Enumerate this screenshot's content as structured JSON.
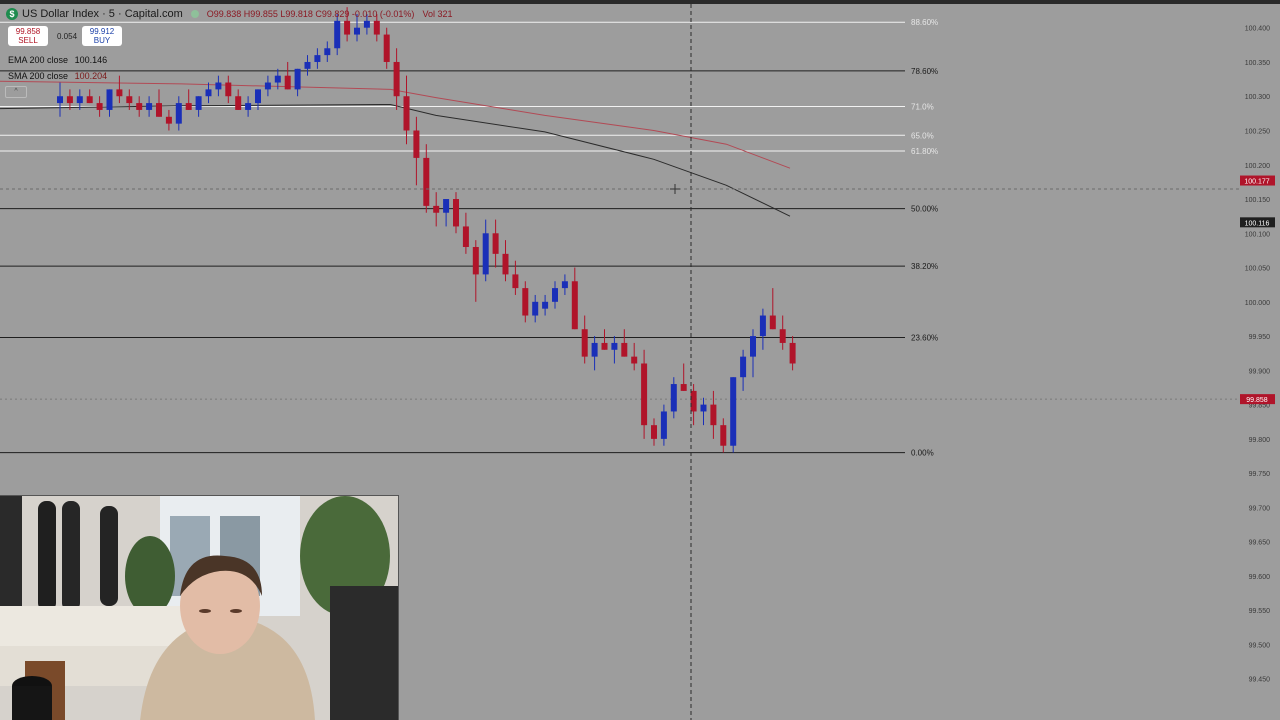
{
  "header": {
    "title": "US Dollar Index · 5 · Capital.com",
    "ohlc": "O99.838  H99.855  L99.818  C99.829  -0.010 (-0.01%)",
    "volume": "Vol 321"
  },
  "trade": {
    "sell_price": "99.858",
    "sell_label": "SELL",
    "spread": "0.054",
    "buy_price": "99.912",
    "buy_label": "BUY"
  },
  "indicators": [
    {
      "label": "EMA 200 close",
      "value": "100.146",
      "value2": ""
    },
    {
      "label": "SMA 200 close",
      "value": "100.204",
      "value2": ""
    }
  ],
  "colors": {
    "background": "#9d9d9d",
    "bull": "#1a2fb8",
    "bear": "#b0142a",
    "ema": "#2b2b2b",
    "sma": "#b24a55",
    "fib_line": "#1f1f1f",
    "fib_white": "#f2f2f2"
  },
  "chart_data": {
    "type": "candlestick",
    "title": "US Dollar Index · 5 · Capital.com",
    "y_axis_ticks": [
      "100.400",
      "100.350",
      "100.300",
      "100.250",
      "100.200",
      "100.150",
      "100.100",
      "100.050",
      "100.000",
      "99.950",
      "99.900",
      "99.850",
      "99.800",
      "99.750",
      "99.700",
      "99.650",
      "99.600",
      "99.550",
      "99.500",
      "99.450"
    ],
    "ylim": [
      99.435,
      100.42
    ],
    "price_labels": [
      {
        "text": "100.177",
        "value": 100.177,
        "color": "#b0142a"
      },
      {
        "text": "100.116",
        "value": 100.116,
        "color": "#1f1f1f"
      },
      {
        "text": "99.858",
        "value": 99.858,
        "color": "#b0142a"
      }
    ],
    "fib_levels": [
      {
        "label": "88.60%",
        "value": 100.408,
        "style": "white"
      },
      {
        "label": "78.60%",
        "value": 100.337,
        "style": "dark"
      },
      {
        "label": "71.0%",
        "value": 100.285,
        "style": "white"
      },
      {
        "label": "65.0%",
        "value": 100.243,
        "style": "white"
      },
      {
        "label": "61.80%",
        "value": 100.22,
        "style": "white"
      },
      {
        "label": "50.00%",
        "value": 100.136,
        "style": "dark"
      },
      {
        "label": "38.20%",
        "value": 100.052,
        "style": "dark"
      },
      {
        "label": "23.60%",
        "value": 99.948,
        "style": "dark"
      },
      {
        "label": "0.00%",
        "value": 99.78,
        "style": "dark"
      }
    ],
    "candles": [
      [
        100.29,
        100.32,
        100.27,
        100.3
      ],
      [
        100.3,
        100.31,
        100.28,
        100.29
      ],
      [
        100.29,
        100.31,
        100.28,
        100.3
      ],
      [
        100.3,
        100.31,
        100.29,
        100.29
      ],
      [
        100.29,
        100.3,
        100.27,
        100.28
      ],
      [
        100.28,
        100.31,
        100.27,
        100.31
      ],
      [
        100.31,
        100.33,
        100.29,
        100.3
      ],
      [
        100.3,
        100.31,
        100.28,
        100.29
      ],
      [
        100.29,
        100.3,
        100.27,
        100.28
      ],
      [
        100.28,
        100.3,
        100.27,
        100.29
      ],
      [
        100.29,
        100.31,
        100.27,
        100.27
      ],
      [
        100.27,
        100.28,
        100.25,
        100.26
      ],
      [
        100.26,
        100.3,
        100.25,
        100.29
      ],
      [
        100.29,
        100.31,
        100.28,
        100.28
      ],
      [
        100.28,
        100.3,
        100.27,
        100.3
      ],
      [
        100.3,
        100.32,
        100.29,
        100.31
      ],
      [
        100.31,
        100.33,
        100.3,
        100.32
      ],
      [
        100.32,
        100.33,
        100.29,
        100.3
      ],
      [
        100.3,
        100.31,
        100.28,
        100.28
      ],
      [
        100.28,
        100.3,
        100.27,
        100.29
      ],
      [
        100.29,
        100.31,
        100.28,
        100.31
      ],
      [
        100.31,
        100.33,
        100.3,
        100.32
      ],
      [
        100.32,
        100.34,
        100.31,
        100.33
      ],
      [
        100.33,
        100.35,
        100.31,
        100.31
      ],
      [
        100.31,
        100.34,
        100.3,
        100.34
      ],
      [
        100.34,
        100.36,
        100.33,
        100.35
      ],
      [
        100.35,
        100.37,
        100.34,
        100.36
      ],
      [
        100.36,
        100.38,
        100.35,
        100.37
      ],
      [
        100.37,
        100.42,
        100.36,
        100.41
      ],
      [
        100.41,
        100.43,
        100.38,
        100.39
      ],
      [
        100.39,
        100.42,
        100.38,
        100.4
      ],
      [
        100.4,
        100.42,
        100.39,
        100.41
      ],
      [
        100.41,
        100.42,
        100.38,
        100.39
      ],
      [
        100.39,
        100.4,
        100.34,
        100.35
      ],
      [
        100.35,
        100.37,
        100.28,
        100.3
      ],
      [
        100.3,
        100.33,
        100.23,
        100.25
      ],
      [
        100.25,
        100.27,
        100.17,
        100.21
      ],
      [
        100.21,
        100.23,
        100.13,
        100.14
      ],
      [
        100.14,
        100.16,
        100.11,
        100.13
      ],
      [
        100.13,
        100.15,
        100.11,
        100.15
      ],
      [
        100.15,
        100.16,
        100.1,
        100.11
      ],
      [
        100.11,
        100.13,
        100.07,
        100.08
      ],
      [
        100.08,
        100.09,
        100.0,
        100.04
      ],
      [
        100.04,
        100.12,
        100.03,
        100.1
      ],
      [
        100.1,
        100.12,
        100.05,
        100.07
      ],
      [
        100.07,
        100.09,
        100.03,
        100.04
      ],
      [
        100.04,
        100.06,
        100.01,
        100.02
      ],
      [
        100.02,
        100.03,
        99.97,
        99.98
      ],
      [
        99.98,
        100.01,
        99.97,
        100.0
      ],
      [
        99.99,
        100.01,
        99.98,
        100.0
      ],
      [
        100.0,
        100.03,
        99.99,
        100.02
      ],
      [
        100.02,
        100.04,
        100.01,
        100.03
      ],
      [
        100.03,
        100.05,
        99.96,
        99.96
      ],
      [
        99.96,
        99.98,
        99.91,
        99.92
      ],
      [
        99.92,
        99.95,
        99.9,
        99.94
      ],
      [
        99.94,
        99.96,
        99.93,
        99.93
      ],
      [
        99.93,
        99.95,
        99.91,
        99.94
      ],
      [
        99.94,
        99.96,
        99.92,
        99.92
      ],
      [
        99.92,
        99.94,
        99.9,
        99.91
      ],
      [
        99.91,
        99.93,
        99.8,
        99.82
      ],
      [
        99.82,
        99.83,
        99.79,
        99.8
      ],
      [
        99.8,
        99.85,
        99.79,
        99.84
      ],
      [
        99.84,
        99.89,
        99.83,
        99.88
      ],
      [
        99.88,
        99.91,
        99.87,
        99.87
      ],
      [
        99.87,
        99.88,
        99.82,
        99.84
      ],
      [
        99.84,
        99.86,
        99.82,
        99.85
      ],
      [
        99.85,
        99.87,
        99.8,
        99.82
      ],
      [
        99.82,
        99.83,
        99.78,
        99.79
      ],
      [
        99.79,
        99.89,
        99.78,
        99.89
      ],
      [
        99.89,
        99.93,
        99.87,
        99.92
      ],
      [
        99.92,
        99.96,
        99.89,
        99.95
      ],
      [
        99.95,
        99.99,
        99.93,
        99.98
      ],
      [
        99.98,
        100.02,
        99.96,
        99.96
      ],
      [
        99.96,
        99.98,
        99.93,
        99.94
      ],
      [
        99.94,
        99.95,
        99.9,
        99.91
      ]
    ],
    "ema_200": [
      100.282,
      100.286,
      100.288,
      100.272,
      100.248,
      100.208,
      100.17,
      100.125
    ],
    "sma_200": [
      100.322,
      100.318,
      100.31,
      100.298,
      100.272,
      100.25,
      100.23,
      100.195
    ],
    "ma_x_fraction": [
      0.0,
      0.2,
      0.43,
      0.48,
      0.6,
      0.72,
      0.8,
      0.87
    ]
  }
}
